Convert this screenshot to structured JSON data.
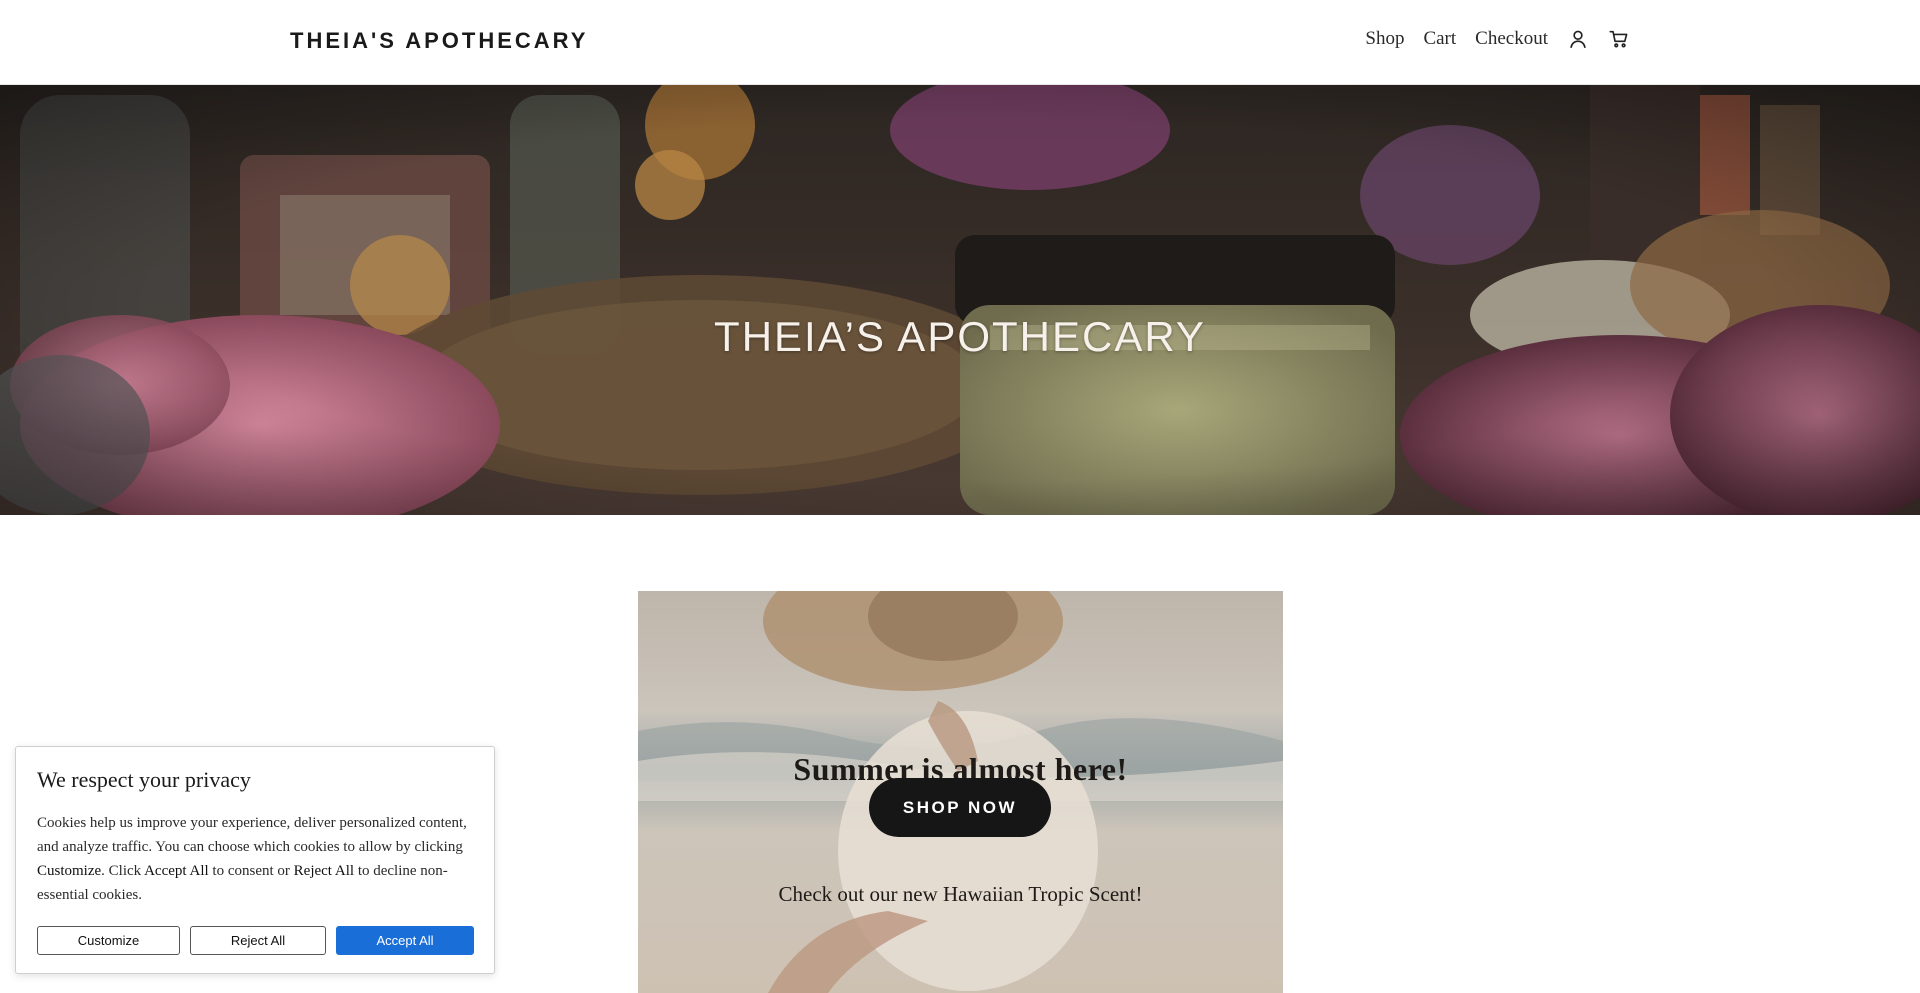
{
  "header": {
    "brand": "THEIA'S APOTHECARY",
    "nav": {
      "shop": "Shop",
      "cart": "Cart",
      "checkout": "Checkout"
    },
    "icons": [
      "account-icon",
      "cart-icon"
    ]
  },
  "hero": {
    "title": "THEIA’S APOTHECARY"
  },
  "promo": {
    "heading": "Summer is almost here!",
    "button_label": "SHOP NOW",
    "subtext": "Check out our new Hawaiian Tropic Scent!"
  },
  "cookie_banner": {
    "title": "We respect your privacy",
    "body_part1": "Cookies help us improve your experience, deliver personalized content, and analyze traffic. You can choose which cookies to allow by clicking ",
    "body_customize": "Customize",
    "body_part2": ". Click ",
    "body_accept": "Accept All",
    "body_part3": " to consent or ",
    "body_reject": "Reject All",
    "body_part4": " to decline non-essential cookies.",
    "buttons": {
      "customize": "Customize",
      "reject": "Reject All",
      "accept": "Accept All"
    }
  },
  "colors": {
    "accept_button": "#1a6ed8",
    "promo_button": "#161616",
    "hero_text": "#f6f1ea"
  }
}
